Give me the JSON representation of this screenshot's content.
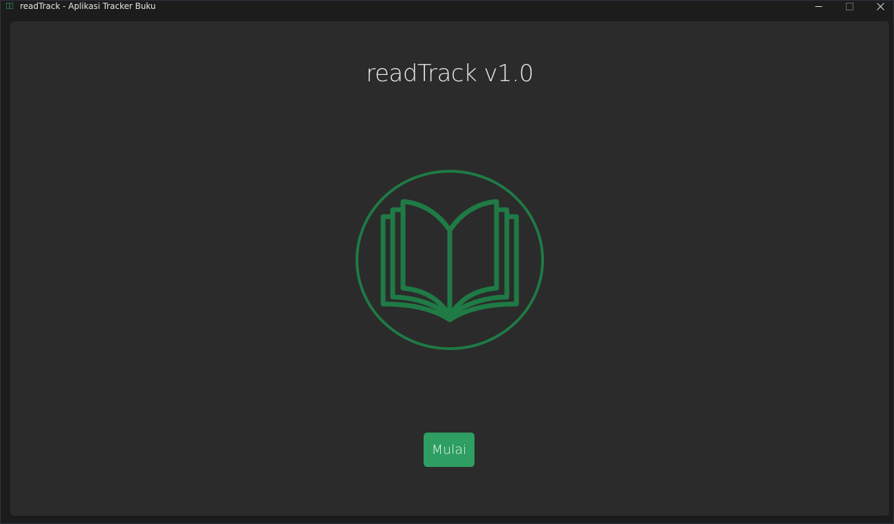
{
  "window": {
    "title": "readTrack - Aplikasi Tracker Buku",
    "controls": {
      "minimize_icon": "minimize-icon",
      "maximize_icon": "maximize-icon",
      "close_icon": "close-icon"
    }
  },
  "main": {
    "heading": "readTrack v1.0",
    "logo_icon": "open-book-icon",
    "start_button_label": "Mulai"
  },
  "colors": {
    "window_bg": "#1c1c1c",
    "content_bg": "#2b2b2b",
    "logo_green": "#1f7a45",
    "button_green": "#2e9e62",
    "text": "#e8e8e8"
  }
}
